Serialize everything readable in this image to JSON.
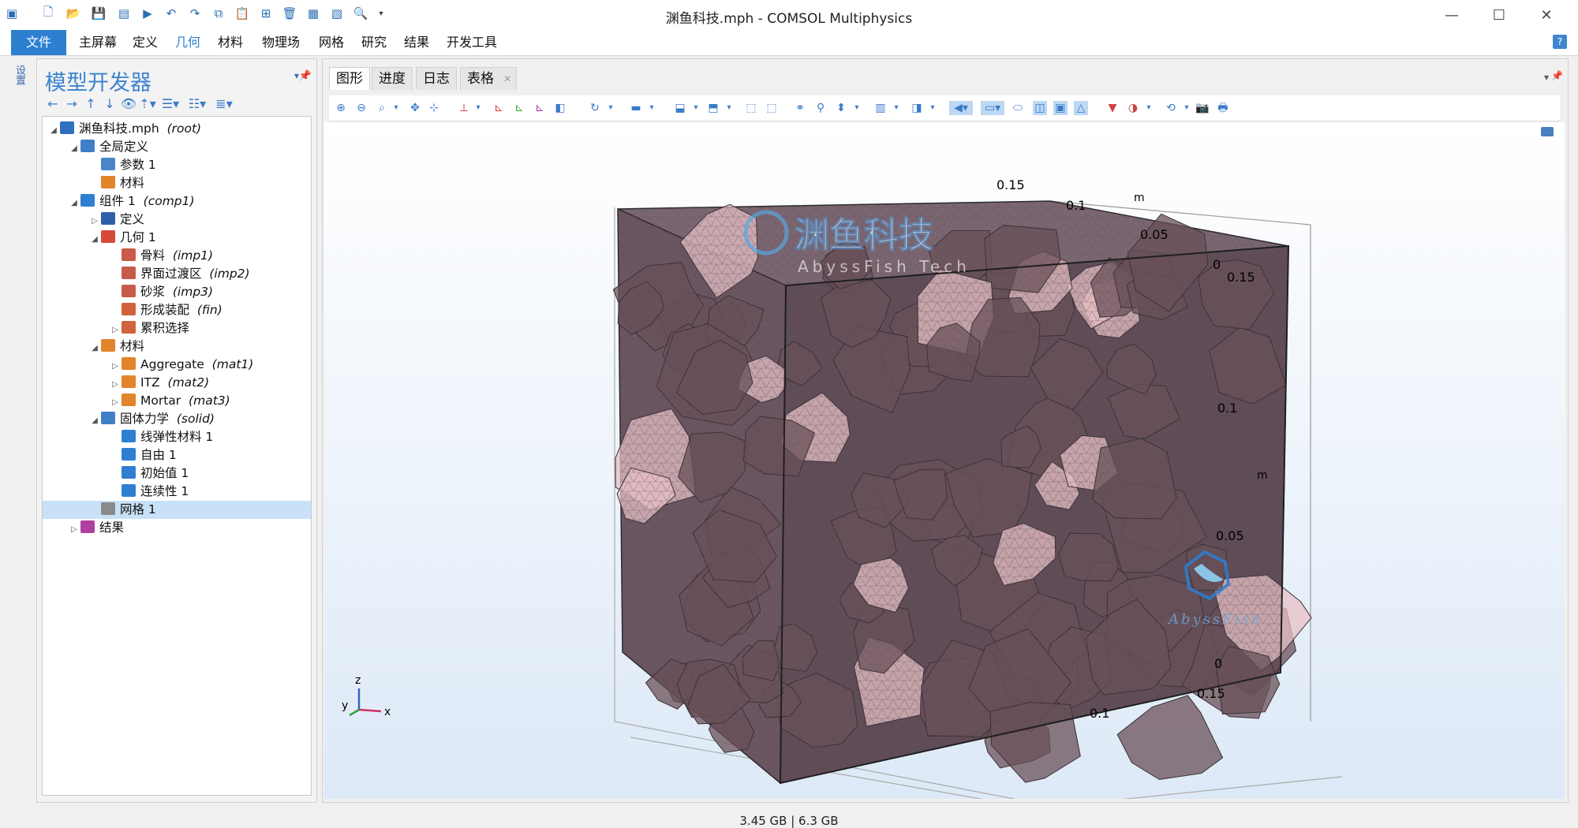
{
  "window": {
    "title": "渊鱼科技.mph - COMSOL Multiphysics"
  },
  "quick_access_icons": [
    "app-icon",
    "new-file-icon",
    "open-folder-icon",
    "save-icon",
    "save-as-icon",
    "run-icon",
    "undo-icon",
    "redo-icon",
    "copy-icon",
    "paste-icon",
    "duplicate-icon",
    "delete-icon",
    "select-all-icon",
    "deselect-icon",
    "find-icon",
    "dropdown-icon"
  ],
  "menu": {
    "file": "文件",
    "home": "主屏幕",
    "definitions": "定义",
    "geometry": "几何",
    "materials": "材料",
    "physics": "物理场",
    "mesh": "网格",
    "study": "研究",
    "results": "结果",
    "developer": "开发工具",
    "help": "?"
  },
  "side_strip": {
    "label": "设置"
  },
  "model_builder": {
    "title": "模型开发器",
    "tree": [
      {
        "label": "渊鱼科技.mph",
        "tag": "(root)",
        "level": 0,
        "expanded": true,
        "icon": "root-icon",
        "color": "#2f6fbf"
      },
      {
        "label": "全局定义",
        "tag": "",
        "level": 1,
        "expanded": true,
        "icon": "globe-icon",
        "color": "#3f7fc8"
      },
      {
        "label": "参数 1",
        "tag": "",
        "level": 2,
        "expanded": null,
        "icon": "parameter-icon",
        "color": "#4a86c7"
      },
      {
        "label": "材料",
        "tag": "",
        "level": 2,
        "expanded": null,
        "icon": "material-icon",
        "color": "#e2842a"
      },
      {
        "label": "组件 1",
        "tag": "(comp1)",
        "level": 1,
        "expanded": true,
        "icon": "component-icon",
        "color": "#2f7fd0"
      },
      {
        "label": "定义",
        "tag": "",
        "level": 2,
        "expanded": false,
        "icon": "definitions-icon",
        "color": "#2f5fa8"
      },
      {
        "label": "几何 1",
        "tag": "",
        "level": 2,
        "expanded": true,
        "icon": "geometry-icon",
        "color": "#d64a3a"
      },
      {
        "label": "骨料",
        "tag": "(imp1)",
        "level": 3,
        "expanded": null,
        "icon": "import-icon",
        "color": "#c85a4a"
      },
      {
        "label": "界面过渡区",
        "tag": "(imp2)",
        "level": 3,
        "expanded": null,
        "icon": "import-icon",
        "color": "#c85a4a"
      },
      {
        "label": "砂浆",
        "tag": "(imp3)",
        "level": 3,
        "expanded": null,
        "icon": "import-icon",
        "color": "#c85a4a"
      },
      {
        "label": "形成装配",
        "tag": "(fin)",
        "level": 3,
        "expanded": null,
        "icon": "form-assembly-icon",
        "color": "#d0623c"
      },
      {
        "label": "累积选择",
        "tag": "",
        "level": 3,
        "expanded": false,
        "icon": "selection-icon",
        "color": "#d0623c"
      },
      {
        "label": "材料",
        "tag": "",
        "level": 2,
        "expanded": true,
        "icon": "material-icon",
        "color": "#e2842a"
      },
      {
        "label": "Aggregate",
        "tag": "(mat1)",
        "level": 3,
        "expanded": false,
        "icon": "material-icon",
        "color": "#e2842a"
      },
      {
        "label": "ITZ",
        "tag": "(mat2)",
        "level": 3,
        "expanded": false,
        "icon": "material-icon",
        "color": "#e2842a"
      },
      {
        "label": "Mortar",
        "tag": "(mat3)",
        "level": 3,
        "expanded": false,
        "icon": "material-icon",
        "color": "#e2842a"
      },
      {
        "label": "固体力学",
        "tag": "(solid)",
        "level": 2,
        "expanded": true,
        "icon": "solid-mechanics-icon",
        "color": "#3f7fc8"
      },
      {
        "label": "线弹性材料 1",
        "tag": "",
        "level": 3,
        "expanded": null,
        "icon": "domain-node-icon",
        "color": "#2f7fd0"
      },
      {
        "label": "自由 1",
        "tag": "",
        "level": 3,
        "expanded": null,
        "icon": "domain-node-icon",
        "color": "#2f7fd0"
      },
      {
        "label": "初始值 1",
        "tag": "",
        "level": 3,
        "expanded": null,
        "icon": "domain-node-icon",
        "color": "#2f7fd0"
      },
      {
        "label": "连续性 1",
        "tag": "",
        "level": 3,
        "expanded": null,
        "icon": "domain-node-icon",
        "color": "#2f7fd0"
      },
      {
        "label": "网格 1",
        "tag": "",
        "level": 2,
        "expanded": null,
        "icon": "mesh-icon",
        "color": "#8a8a8a",
        "selected": true
      },
      {
        "label": "结果",
        "tag": "",
        "level": 1,
        "expanded": false,
        "icon": "results-icon",
        "color": "#b040a0"
      }
    ]
  },
  "graphics": {
    "tabs": [
      "图形",
      "进度",
      "日志",
      "表格"
    ],
    "axes": {
      "x_ticks": [
        "0.1",
        "0.15"
      ],
      "y_ticks": [
        "0.15",
        "0.1",
        "0.05",
        "0"
      ],
      "z_ticks": [
        "0.15",
        "0.1",
        "0.05",
        "0"
      ],
      "unit": "m",
      "triad": {
        "x": "x",
        "y": "y",
        "z": "z"
      }
    },
    "mesh_colors": {
      "face": "#6a5058",
      "wire": "#3a3038",
      "highlight": "#e7c0c6"
    },
    "watermark": {
      "cn": "渊鱼科技",
      "en": "AbyssFish Tech",
      "logo_text": "AbyssFish"
    }
  },
  "status": {
    "memory": "3.45 GB | 6.3 GB"
  }
}
